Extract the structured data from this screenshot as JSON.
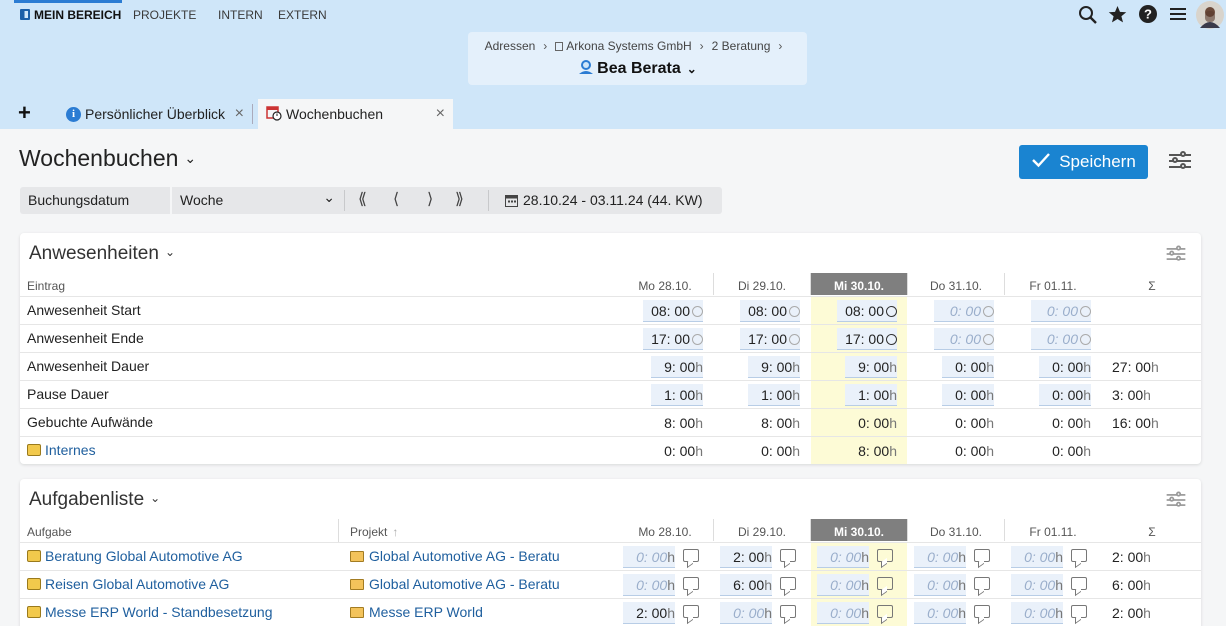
{
  "nav": {
    "items": [
      "Mein Bereich",
      "Projekte",
      "Intern",
      "Extern"
    ]
  },
  "icons": {
    "search": "search-icon",
    "star": "star-icon",
    "help": "help-icon",
    "menu": "hamburger-menu-icon",
    "avatar": "user-avatar"
  },
  "breadcrumb": {
    "items": [
      "Adressen",
      "Arkona Systems GmbH",
      "2 Beratung"
    ],
    "person": "Bea Berata"
  },
  "tabs": [
    {
      "label": "Persönlicher Überblick"
    },
    {
      "label": "Wochenbuchen"
    }
  ],
  "page": {
    "title": "Wochenbuchen",
    "save_label": "Speichern"
  },
  "toolbar": {
    "field_label": "Buchungsdatum",
    "period": "Woche",
    "date_range": "28.10.24 - 03.11.24 (44. KW)"
  },
  "colors": {
    "accent": "#1a84d1",
    "header_bg": "#cfe6f9",
    "today_bg": "#fdfbd6"
  },
  "days": [
    "Mo 28.10.",
    "Di 29.10.",
    "Mi 30.10.",
    "Do 31.10.",
    "Fr 01.11."
  ],
  "sum_label": "Σ",
  "anwesenheiten": {
    "title": "Anwesenheiten",
    "entry_header": "Eintrag",
    "rows": [
      {
        "label": "Anwesenheit Start",
        "values": [
          "08: 00",
          "08: 00",
          "08: 00",
          "0: 00",
          "0: 00"
        ],
        "sum": ""
      },
      {
        "label": "Anwesenheit Ende",
        "values": [
          "17: 00",
          "17: 00",
          "17: 00",
          "0: 00",
          "0: 00"
        ],
        "sum": ""
      },
      {
        "label": "Anwesenheit Dauer",
        "values": [
          "9: 00",
          "9: 00",
          "9: 00",
          "0: 00",
          "0: 00"
        ],
        "sum": "27: 00"
      },
      {
        "label": "Pause Dauer",
        "values": [
          "1: 00",
          "1: 00",
          "1: 00",
          "0: 00",
          "0: 00"
        ],
        "sum": "3: 00"
      },
      {
        "label": "Gebuchte Aufwände",
        "values": [
          "8: 00",
          "8: 00",
          "0: 00",
          "0: 00",
          "0: 00"
        ],
        "sum": "16: 00"
      },
      {
        "label": "Internes",
        "values": [
          "0: 00",
          "0: 00",
          "8: 00",
          "0: 00",
          "0: 00"
        ],
        "sum": ""
      }
    ]
  },
  "aufgaben": {
    "title": "Aufgabenliste",
    "task_header": "Aufgabe",
    "project_header": "Projekt",
    "rows": [
      {
        "task": "Beratung Global Automotive AG",
        "project": "Global Automotive AG - Beratur",
        "values": [
          "0: 00",
          "2: 00",
          "0: 00",
          "0: 00",
          "0: 00"
        ],
        "sum": "2: 00"
      },
      {
        "task": "Reisen Global Automotive AG",
        "project": "Global Automotive AG - Beratur",
        "values": [
          "0: 00",
          "6: 00",
          "0: 00",
          "0: 00",
          "0: 00"
        ],
        "sum": "6: 00"
      },
      {
        "task": "Messe ERP World - Standbesetzung",
        "project": "Messe ERP World",
        "values": [
          "2: 00",
          "0: 00",
          "0: 00",
          "0: 00",
          "0: 00"
        ],
        "sum": "2: 00"
      }
    ]
  },
  "unit_h": "h"
}
